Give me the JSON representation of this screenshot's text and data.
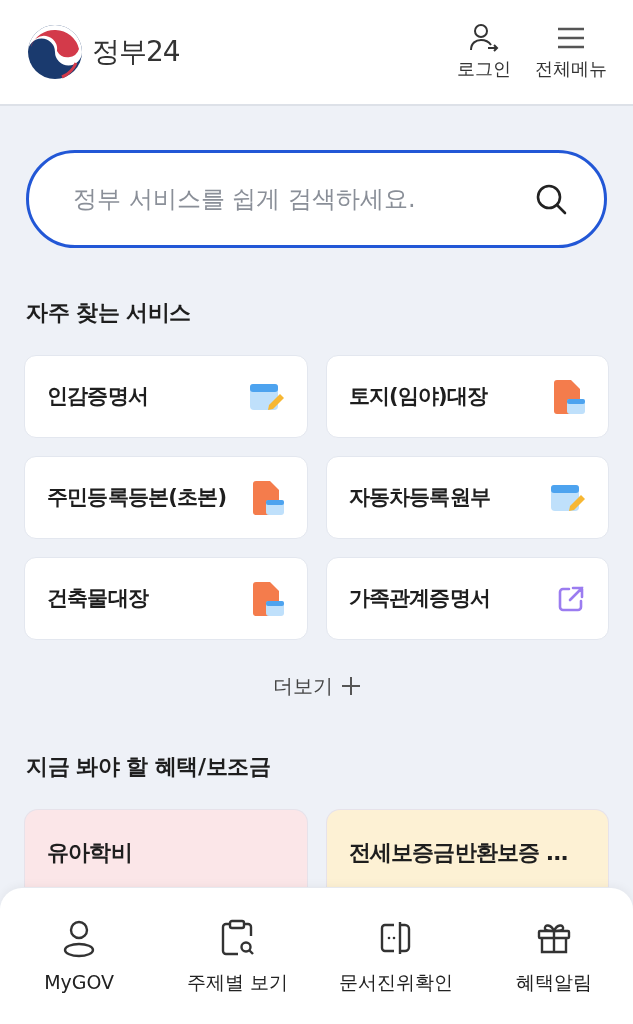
{
  "header": {
    "logo_text": "정부24",
    "actions": [
      {
        "kind": "login",
        "label": "로그인"
      },
      {
        "kind": "menu",
        "label": "전체메뉴"
      }
    ]
  },
  "search": {
    "placeholder": "정부 서비스를 쉽게 검색하세요."
  },
  "frequent": {
    "title": "자주 찾는 서비스",
    "items": [
      {
        "label": "인감증명서",
        "kind": "pc"
      },
      {
        "label": "토지(임야)대장",
        "kind": "pdf"
      },
      {
        "label": "주민등록등본(초본)",
        "kind": "pdf"
      },
      {
        "label": "자동차등록원부",
        "kind": "pc"
      },
      {
        "label": "건축물대장",
        "kind": "pdf"
      },
      {
        "label": "가족관계증명서",
        "kind": "external"
      }
    ],
    "more": "더보기"
  },
  "benefits": {
    "title": "지금 봐야 할 혜택/보조금",
    "items": [
      {
        "label": "유아학비",
        "color": "#fbe6e8"
      },
      {
        "label": "전세보증금반환보증 …",
        "color": "#fdf1d4"
      }
    ]
  },
  "bottom_nav": [
    {
      "kind": "person",
      "label": "MyGOV"
    },
    {
      "kind": "topic",
      "label": "주제별 보기"
    },
    {
      "kind": "verify",
      "label": "문서진위확인"
    },
    {
      "kind": "gift",
      "label": "혜택알림"
    }
  ]
}
